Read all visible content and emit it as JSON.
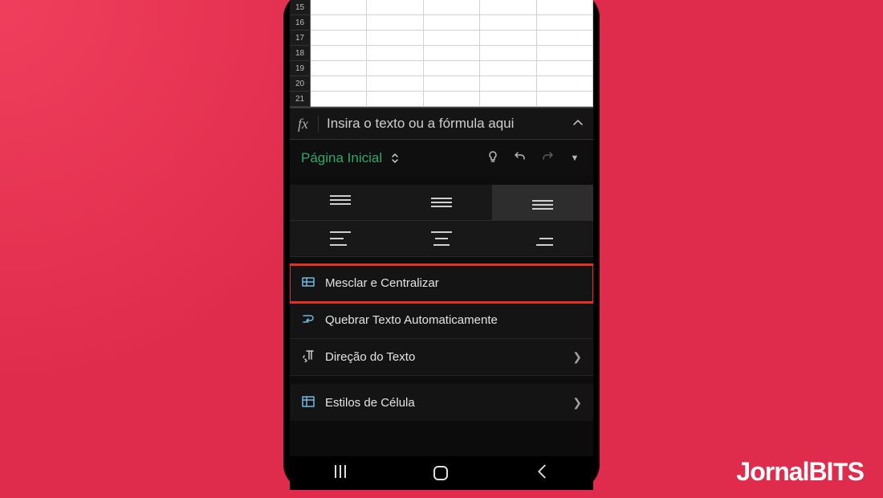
{
  "sheet": {
    "rows": [
      "15",
      "16",
      "17",
      "18",
      "19",
      "20",
      "21"
    ],
    "cols": 5
  },
  "formula_bar": {
    "fx": "fx",
    "placeholder": "Insira o texto ou a fórmula aqui"
  },
  "ribbon": {
    "tab": "Página Inicial"
  },
  "options": {
    "merge": "Mesclar e Centralizar",
    "wrap": "Quebrar Texto Automaticamente",
    "direction": "Direção do Texto",
    "styles": "Estilos de Célula"
  },
  "watermark": {
    "pre": "JornalBI",
    "t": "T",
    "post": "S"
  },
  "colors": {
    "accent": "#2fa86a",
    "highlight": "#e63027",
    "bg": "#e02c4c"
  }
}
